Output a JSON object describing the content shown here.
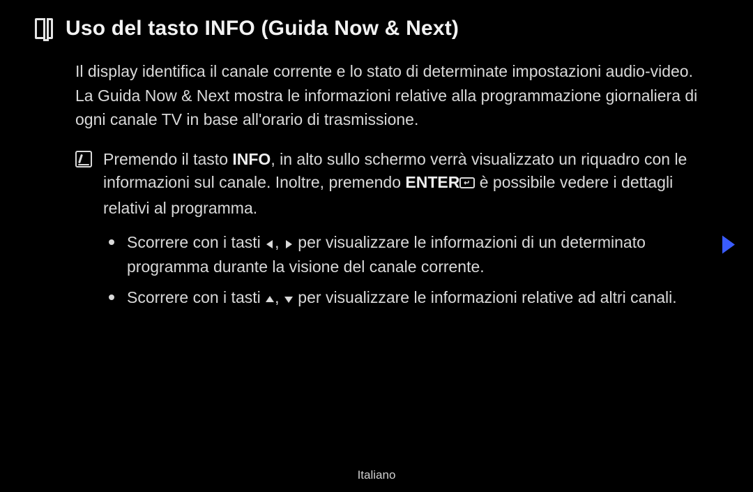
{
  "title": "Uso del tasto INFO (Guida Now & Next)",
  "para1": "Il display identifica il canale corrente e lo stato di determinate impostazioni audio-video.",
  "para2": "La Guida Now & Next mostra le informazioni relative alla programmazione giornaliera di ogni canale TV in base all'orario di trasmissione.",
  "note": {
    "seg1": "Premendo il tasto ",
    "info": "INFO",
    "seg2": ", in alto sullo schermo verrà visualizzato un riquadro con le informazioni sul canale. Inoltre, premendo ",
    "enter": "ENTER",
    "seg3": " è possibile vedere i dettagli relativi al programma."
  },
  "bullet1": {
    "a": "Scorrere con i tasti ",
    "b": " per visualizzare le informazioni di un determinato programma durante la visione del canale corrente."
  },
  "bullet2": {
    "a": "Scorrere con i tasti ",
    "b": " per visualizzare le informazioni relative ad altri canali."
  },
  "footer": "Italiano"
}
